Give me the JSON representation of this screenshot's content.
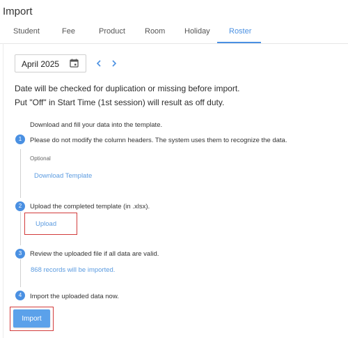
{
  "page": {
    "title": "Import"
  },
  "tabs": [
    {
      "label": "Student"
    },
    {
      "label": "Fee"
    },
    {
      "label": "Product"
    },
    {
      "label": "Room"
    },
    {
      "label": "Holiday"
    },
    {
      "label": "Roster",
      "active": true
    }
  ],
  "month_picker": {
    "value": "April 2025"
  },
  "notices": [
    "Date will be checked for duplication or missing before import.",
    "Put \"Off\" in Start Time (1st session) will result as off duty."
  ],
  "steps": [
    {
      "number": "1",
      "lines": [
        "Download and fill your data into the template.",
        "Please do not modify the column headers. The system uses them to recognize the data."
      ],
      "optional_label": "Optional",
      "link": "Download Template"
    },
    {
      "number": "2",
      "lines": [
        "Upload the completed template (in .xlsx)."
      ],
      "link": "Upload"
    },
    {
      "number": "3",
      "lines": [
        "Review the uploaded file if all data are valid."
      ],
      "link": "868 records will be imported."
    },
    {
      "number": "4",
      "lines": [
        "Import the uploaded data now."
      ],
      "button": "Import"
    }
  ],
  "colors": {
    "accent": "#4a90e2",
    "highlight_border": "#d23b3b"
  }
}
